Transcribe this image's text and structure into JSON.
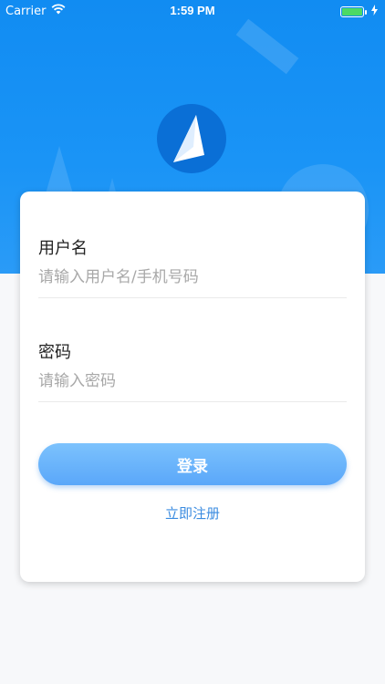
{
  "status_bar": {
    "carrier": "Carrier",
    "time": "1:59 PM",
    "battery_color": "#4cd964"
  },
  "icons": {
    "wifi": "wifi-icon",
    "battery": "battery-icon",
    "charging": "bolt-icon",
    "logo": "app-logo-icon"
  },
  "login_form": {
    "username": {
      "label": "用户名",
      "placeholder": "请输入用户名/手机号码",
      "value": ""
    },
    "password": {
      "label": "密码",
      "placeholder": "请输入密码",
      "value": ""
    },
    "submit_label": "登录",
    "register_label": "立即注册"
  },
  "colors": {
    "hero_blue": "#118cf2",
    "button_blue": "#6bb6fb",
    "link_blue": "#3a8be0"
  }
}
